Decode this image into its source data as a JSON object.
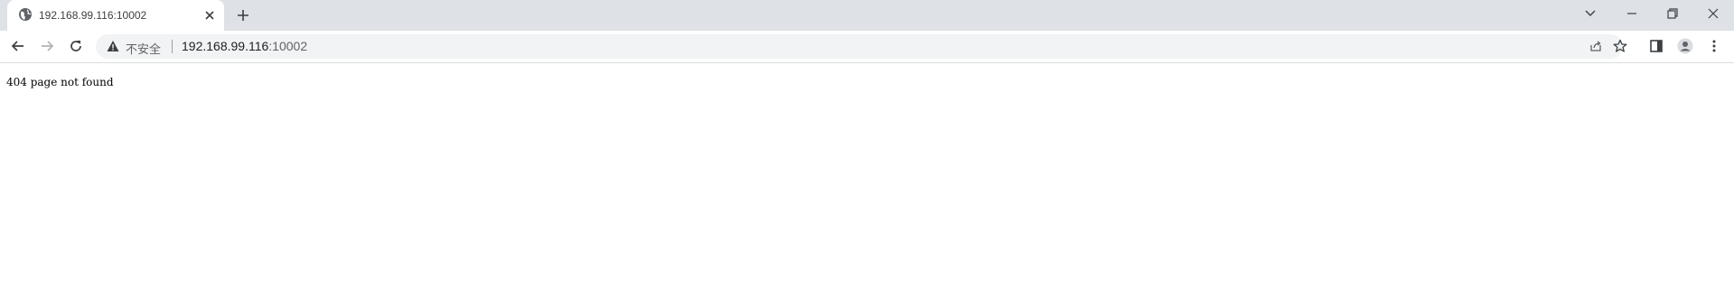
{
  "tab": {
    "title": "192.168.99.116:10002",
    "favicon": "globe-icon"
  },
  "toolbar": {
    "security_label": "不安全",
    "url_host": "192.168.99.116",
    "url_port": ":10002"
  },
  "page": {
    "text": "404 page not found"
  },
  "colors": {
    "tabstrip_bg": "#dee1e6",
    "omnibox_bg": "#f1f3f4",
    "icon": "#5f6368"
  }
}
